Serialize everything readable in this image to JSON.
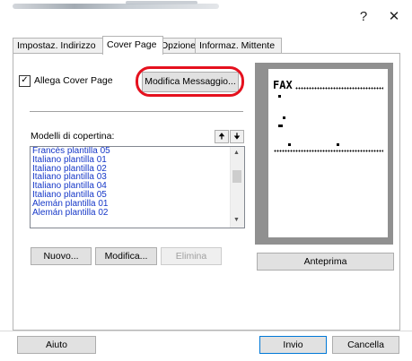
{
  "window": {
    "help_glyph": "?",
    "close_glyph": "✕"
  },
  "tabs": [
    {
      "label": "Impostaz. Indirizzo",
      "active": false
    },
    {
      "label": "Cover Page",
      "active": true
    },
    {
      "label": "Opzione",
      "active": false
    },
    {
      "label": "Informaz. Mittente",
      "active": false
    }
  ],
  "cover": {
    "attach_label": "Allega Cover Page",
    "attach_checked": true,
    "edit_message_button": "Modifica Messaggio...",
    "templates_label": "Modelli di copertina:",
    "templates": [
      "Francés plantilla 05",
      "Italiano plantilla 01",
      "Italiano plantilla 02",
      "Italiano plantilla 03",
      "Italiano plantilla 04",
      "Italiano plantilla 05",
      "Alemán plantilla 01",
      "Alemán plantilla 02"
    ],
    "new_button": "Nuovo...",
    "edit_button": "Modifica...",
    "delete_button": "Elimina",
    "preview_button": "Anteprima",
    "preview_fax_text": "FAX"
  },
  "footer": {
    "help_button": "Aiuto",
    "send_button": "Invio",
    "cancel_button": "Cancella"
  },
  "colors": {
    "highlight": "#e5111e",
    "list_text": "#1638c8"
  }
}
